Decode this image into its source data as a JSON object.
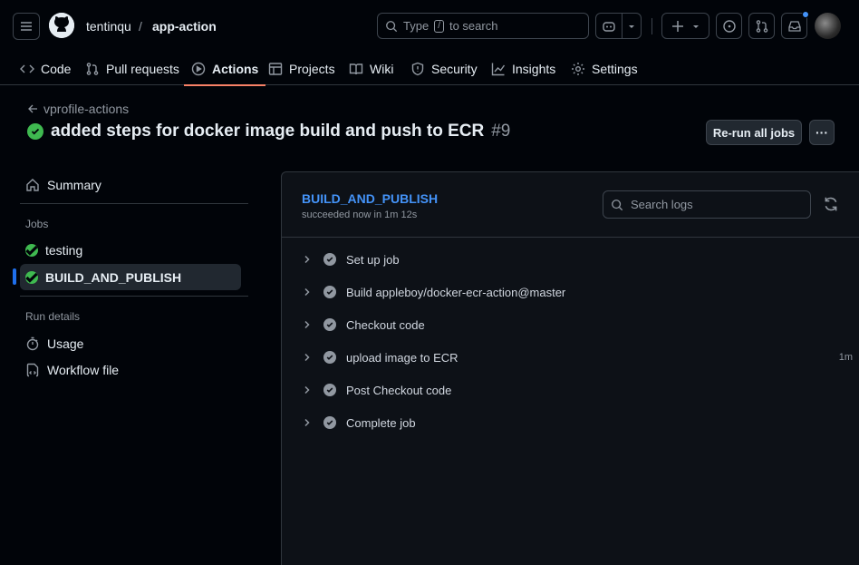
{
  "header": {
    "owner": "tentinqu",
    "separator": "/",
    "repo": "app-action",
    "search": {
      "prefix": "Type",
      "key": "/",
      "suffix": "to search"
    }
  },
  "tabs": [
    {
      "label": "Code",
      "icon": "code-icon"
    },
    {
      "label": "Pull requests",
      "icon": "pull-request-icon"
    },
    {
      "label": "Actions",
      "icon": "play-icon",
      "active": true
    },
    {
      "label": "Projects",
      "icon": "table-icon"
    },
    {
      "label": "Wiki",
      "icon": "book-icon"
    },
    {
      "label": "Security",
      "icon": "shield-icon"
    },
    {
      "label": "Insights",
      "icon": "graph-icon"
    },
    {
      "label": "Settings",
      "icon": "gear-icon"
    }
  ],
  "run": {
    "back_label": "vprofile-actions",
    "title": "added steps for docker image build and push to ECR",
    "number": "#9",
    "rerun_label": "Re-run all jobs",
    "more_label": "···"
  },
  "sidebar": {
    "summary": "Summary",
    "jobs_heading": "Jobs",
    "jobs": [
      {
        "label": "testing"
      },
      {
        "label": "BUILD_AND_PUBLISH",
        "active": true
      }
    ],
    "details_heading": "Run details",
    "details": [
      {
        "label": "Usage"
      },
      {
        "label": "Workflow file"
      }
    ]
  },
  "job": {
    "name": "BUILD_AND_PUBLISH",
    "status": "succeeded now in 1m 12s",
    "search_placeholder": "Search logs",
    "steps": [
      {
        "label": "Set up job",
        "duration": ""
      },
      {
        "label": "Build appleboy/docker-ecr-action@master",
        "duration": ""
      },
      {
        "label": "Checkout code",
        "duration": ""
      },
      {
        "label": "upload image to ECR",
        "duration": "1m"
      },
      {
        "label": "Post Checkout code",
        "duration": ""
      },
      {
        "label": "Complete job",
        "duration": ""
      }
    ]
  },
  "colors": {
    "success": "#3fb950",
    "link": "#4493f8",
    "accent": "#f78166",
    "background": "#010409"
  }
}
